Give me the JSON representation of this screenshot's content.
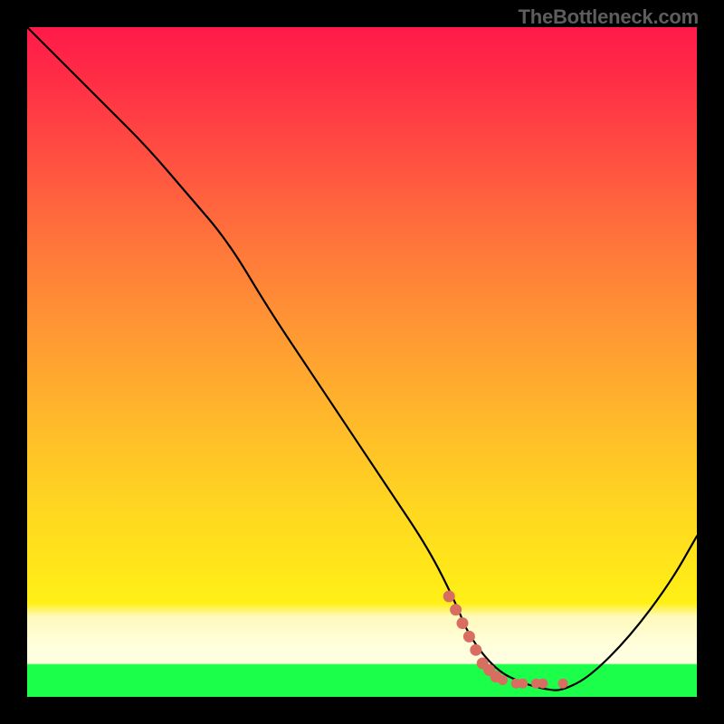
{
  "watermark": "TheBottleneck.com",
  "chart_data": {
    "type": "line",
    "title": "",
    "xlabel": "",
    "ylabel": "",
    "xlim": [
      0,
      100
    ],
    "ylim": [
      0,
      100
    ],
    "series": [
      {
        "name": "bottleneck-curve",
        "x": [
          0,
          5,
          12,
          18,
          24,
          30,
          36,
          42,
          48,
          54,
          60,
          64,
          66,
          70,
          74,
          78,
          80,
          84,
          90,
          96,
          100
        ],
        "y": [
          100,
          95,
          88,
          82,
          75,
          68,
          58,
          49,
          40,
          31,
          22,
          14,
          9,
          4,
          2,
          1,
          1,
          3,
          9,
          17,
          24
        ]
      }
    ],
    "marker_points": {
      "name": "salmon-dots",
      "x": [
        63,
        64,
        65,
        66,
        67,
        68,
        69,
        70,
        71,
        73,
        74,
        76,
        77,
        80
      ],
      "y": [
        15,
        13,
        11,
        9,
        7,
        5,
        4,
        3,
        2.5,
        2,
        2,
        2,
        2,
        2
      ],
      "color": "#d86d62"
    },
    "gradient_stops": [
      {
        "pos": 0.0,
        "color": "#ff1a49"
      },
      {
        "pos": 0.46,
        "color": "#ff9933"
      },
      {
        "pos": 0.8,
        "color": "#ffe51a"
      },
      {
        "pos": 0.92,
        "color": "#ffffdd"
      },
      {
        "pos": 0.95,
        "color": "#1cff4a"
      },
      {
        "pos": 1.0,
        "color": "#1cff4a"
      }
    ]
  }
}
